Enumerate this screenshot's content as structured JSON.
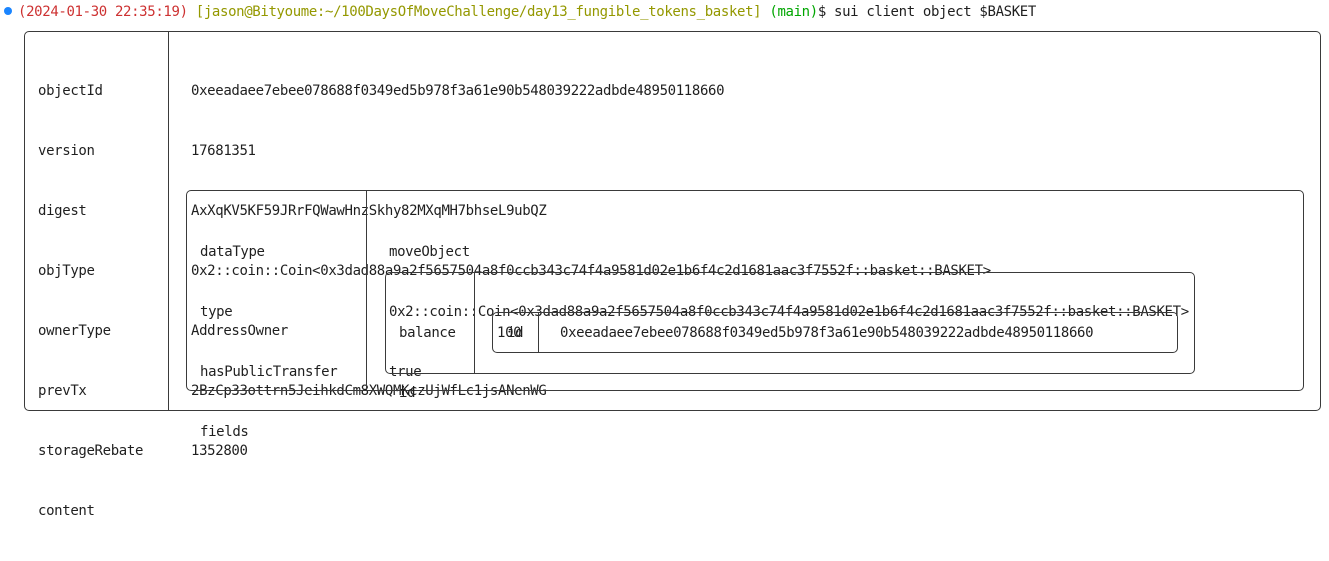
{
  "prompt": {
    "timestamp": "(2024-01-30 22:35:19)",
    "user_path": "[jason@Bityoume:~/100DaysOfMoveChallenge/day13_fungible_tokens_basket]",
    "branch": "(main)",
    "command": "$ sui client object $BASKET"
  },
  "object": {
    "keys": [
      "objectId",
      "version",
      "digest",
      "objType",
      "ownerType",
      "prevTx",
      "storageRebate",
      "content"
    ],
    "values": [
      "0xeeadaee7ebee078688f0349ed5b978f3a61e90b548039222adbde48950118660",
      "17681351",
      "AxXqKV5KF59JRrFQWawHnzSkhy82MXqMH7bhseL9ubQZ",
      "0x2::coin::Coin<0x3dad88a9a2f5657504a8f0ccb343c74f4a9581d02e1b6f4c2d1681aac3f7552f::basket::BASKET>",
      "AddressOwner",
      "2BzCp33ottrn5JeihkdCm8XWQMKczUjWfLc1jsANenWG",
      "1352800"
    ]
  },
  "content": {
    "keys": [
      "dataType",
      "type",
      "hasPublicTransfer",
      "fields"
    ],
    "values": [
      "moveObject",
      "0x2::coin::Coin<0x3dad88a9a2f5657504a8f0ccb343c74f4a9581d02e1b6f4c2d1681aac3f7552f::basket::BASKET>",
      "true"
    ]
  },
  "fields": {
    "keys": [
      "balance",
      "id"
    ],
    "values": [
      "100"
    ]
  },
  "uid": {
    "key": "id",
    "value": "0xeeadaee7ebee078688f0349ed5b978f3a61e90b548039222adbde48950118660"
  },
  "colors": {
    "dot": "#1a85ff",
    "timestamp": "#cd3131",
    "user_path": "#949800",
    "branch": "#00a600",
    "border": "#3a3a3a"
  }
}
